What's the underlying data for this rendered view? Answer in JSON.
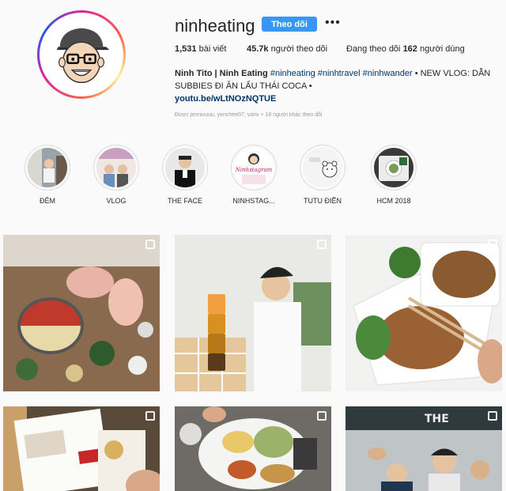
{
  "profile": {
    "username": "ninheating",
    "follow_label": "Theo dõi",
    "more_icon": "more-horizontal-icon",
    "posts_count": "1,531",
    "posts_label": "bài viết",
    "followers_count": "45.7k",
    "followers_label": "người theo dõi",
    "following_prefix": "Đang theo dõi",
    "following_count": "162",
    "following_label": "người dùng",
    "bio_name": "Ninh Tito | Ninh Eating",
    "bio_tags": "#ninheating #ninhtravel #ninhwander",
    "bio_text": "• NEW VLOG: DẪN SUBBIES ĐI ĂN LẨU THÁI COCA •",
    "bio_link": "youtu.be/wLtNOzNQTUE",
    "followed_by": "Được jennivuuu, yenchee07, vanv + 18 người khác theo dõi"
  },
  "highlights": [
    {
      "label": "ĐÊM"
    },
    {
      "label": "VLOG"
    },
    {
      "label": "THE FACE"
    },
    {
      "label": "NINHSTAG..."
    },
    {
      "label": "TUTU ĐIỀN"
    },
    {
      "label": "HCM 2018"
    }
  ],
  "colors": {
    "accent": "#3897f0",
    "link": "#003569",
    "text": "#262626",
    "muted": "#999999",
    "background": "#fafafa"
  }
}
